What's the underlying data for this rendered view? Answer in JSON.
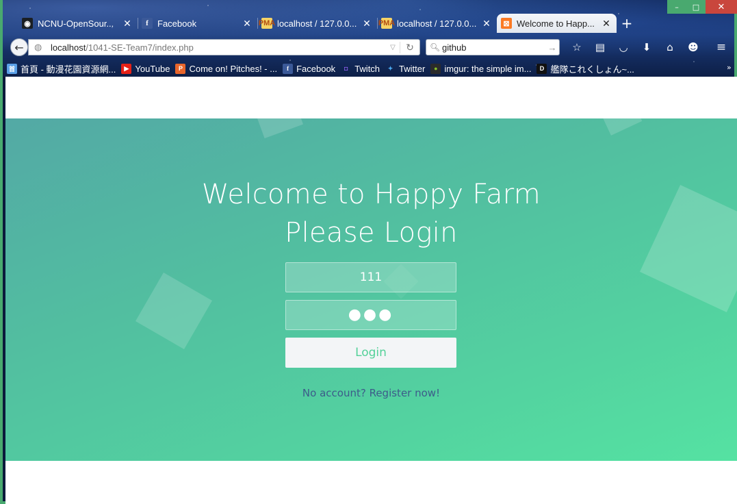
{
  "window": {
    "minimize_glyph": "–",
    "maximize_glyph": "□",
    "close_glyph": "✕"
  },
  "tabs": [
    {
      "title": "NCNU-OpenSour...",
      "favicon": "github-icon",
      "active": false
    },
    {
      "title": "Facebook",
      "favicon": "facebook-icon",
      "active": false
    },
    {
      "title": "localhost / 127.0.0...",
      "favicon": "phpmyadmin-icon",
      "active": false
    },
    {
      "title": "localhost / 127.0.0...",
      "favicon": "phpmyadmin-icon",
      "active": false
    },
    {
      "title": "Welcome to Happ...",
      "favicon": "xampp-icon",
      "active": true
    }
  ],
  "new_tab_glyph": "+",
  "address_bar": {
    "host": "localhost",
    "path": "/1041-SE-Team7/index.php"
  },
  "search_bar": {
    "value": "github"
  },
  "bookmarks": [
    {
      "label": "首頁 - 動漫花園資源網...",
      "icon": "home-icon"
    },
    {
      "label": "YouTube",
      "icon": "youtube-icon"
    },
    {
      "label": "Come on! Pitches! - ...",
      "icon": "pitches-icon"
    },
    {
      "label": "Facebook",
      "icon": "facebook-icon"
    },
    {
      "label": "Twitch",
      "icon": "twitch-icon"
    },
    {
      "label": "Twitter",
      "icon": "twitter-icon"
    },
    {
      "label": "imgur: the simple im...",
      "icon": "imgur-icon"
    },
    {
      "label": "艦隊これくしょん~...",
      "icon": "dmm-icon"
    }
  ],
  "bookmarks_overflow": "»",
  "page": {
    "heading_line1": "Welcome to Happy Farm",
    "heading_line2": "Please Login",
    "username_value": "111",
    "password_value": "●●●",
    "login_label": "Login",
    "register_text": "No account? Register now!"
  },
  "colors": {
    "hero_start": "#53a9a5",
    "hero_end": "#55e2a2",
    "login_text": "#53d199",
    "register_link": "#3d5b8a",
    "window_frame": "#49a96f",
    "close_button": "#c9463d"
  }
}
